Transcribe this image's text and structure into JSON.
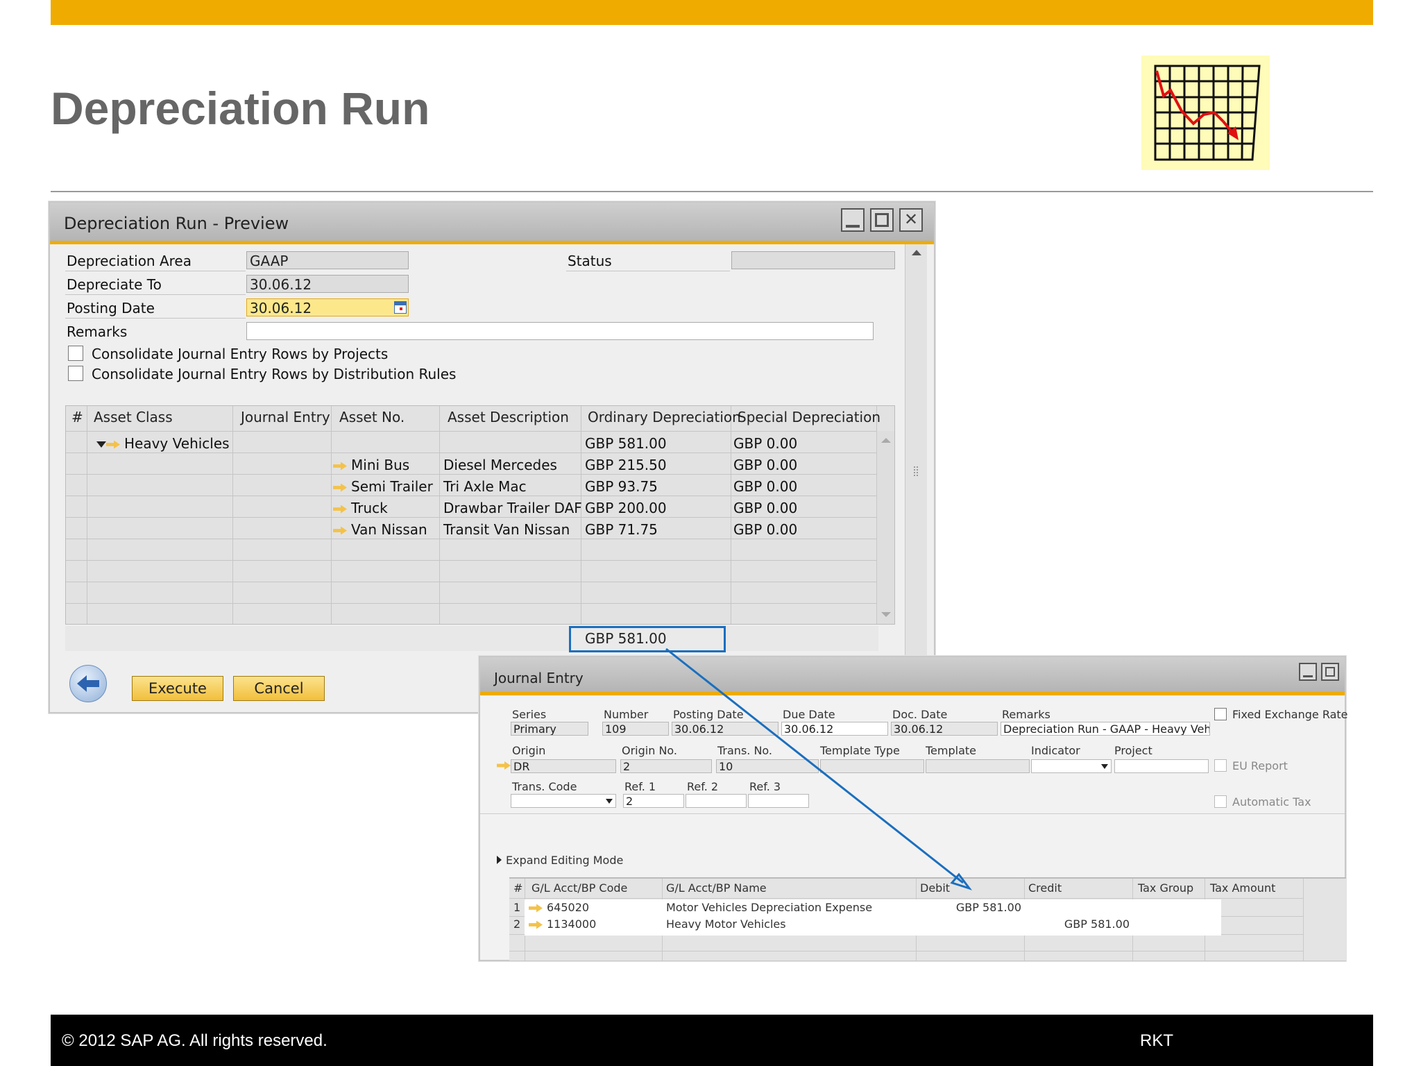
{
  "slide": {
    "title": "Depreciation Run",
    "footer_left": "©  2012 SAP AG. All rights reserved.",
    "footer_right": "RKT",
    "accent": "#f0ab00"
  },
  "preview": {
    "window_title": "Depreciation Run - Preview",
    "fields": {
      "depreciation_area_label": "Depreciation Area",
      "depreciation_area_value": "GAAP",
      "depreciate_to_label": "Depreciate To",
      "depreciate_to_value": "30.06.12",
      "posting_date_label": "Posting Date",
      "posting_date_value": "30.06.12",
      "remarks_label": "Remarks",
      "remarks_value": "",
      "status_label": "Status",
      "status_value": ""
    },
    "checkbox_projects": "Consolidate Journal Entry Rows by Projects",
    "checkbox_distribution": "Consolidate Journal Entry Rows by Distribution Rules",
    "columns": [
      "#",
      "Asset Class",
      "Journal Entry",
      "Asset No.",
      "Asset Description",
      "Ordinary Depreciation",
      "Special Depreciation"
    ],
    "group_row": {
      "asset_class": "Heavy Vehicles",
      "ordinary": "GBP 581.00",
      "special": "GBP 0.00"
    },
    "rows": [
      {
        "asset_no": "Mini Bus",
        "description": "Diesel Mercedes",
        "ordinary": "GBP 215.50",
        "special": "GBP 0.00"
      },
      {
        "asset_no": "Semi Trailer",
        "description": "Tri Axle Mac",
        "ordinary": "GBP 93.75",
        "special": "GBP 0.00"
      },
      {
        "asset_no": "Truck",
        "description": "Drawbar Trailer DAF",
        "ordinary": "GBP 200.00",
        "special": "GBP 0.00"
      },
      {
        "asset_no": "Van Nissan",
        "description": "Transit Van Nissan",
        "ordinary": "GBP 71.75",
        "special": "GBP 0.00"
      }
    ],
    "total_ordinary": "GBP 581.00",
    "execute_label": "Execute",
    "cancel_label": "Cancel"
  },
  "journal": {
    "window_title": "Journal Entry",
    "series_label": "Series",
    "series_value": "Primary",
    "number_label": "Number",
    "number_value": "109",
    "posting_date_label": "Posting Date",
    "posting_date_value": "30.06.12",
    "due_date_label": "Due Date",
    "due_date_value": "30.06.12",
    "doc_date_label": "Doc. Date",
    "doc_date_value": "30.06.12",
    "remarks_label": "Remarks",
    "remarks_value": "Depreciation Run - GAAP - Heavy Vehicl",
    "fixed_rate_label": "Fixed Exchange Rate",
    "origin_label": "Origin",
    "origin_value": "DR",
    "origin_no_label": "Origin No.",
    "origin_no_value": "2",
    "trans_no_label": "Trans. No.",
    "trans_no_value": "10",
    "template_type_label": "Template Type",
    "template_label": "Template",
    "indicator_label": "Indicator",
    "project_label": "Project",
    "eu_report_label": "EU Report",
    "trans_code_label": "Trans. Code",
    "ref1_label": "Ref. 1",
    "ref1_value": "2",
    "ref2_label": "Ref. 2",
    "ref3_label": "Ref. 3",
    "automatic_tax_label": "Automatic Tax",
    "expand_label": "Expand Editing Mode",
    "columns": [
      "#",
      "G/L Acct/BP Code",
      "G/L Acct/BP Name",
      "Debit",
      "Credit",
      "Tax Group",
      "Tax Amount"
    ],
    "rows": [
      {
        "num": "1",
        "code": "645020",
        "name": "Motor Vehicles Depreciation Expense",
        "debit": "GBP 581.00",
        "credit": ""
      },
      {
        "num": "2",
        "code": "1134000",
        "name": "Heavy Motor Vehicles",
        "debit": "",
        "credit": "GBP 581.00"
      }
    ]
  }
}
